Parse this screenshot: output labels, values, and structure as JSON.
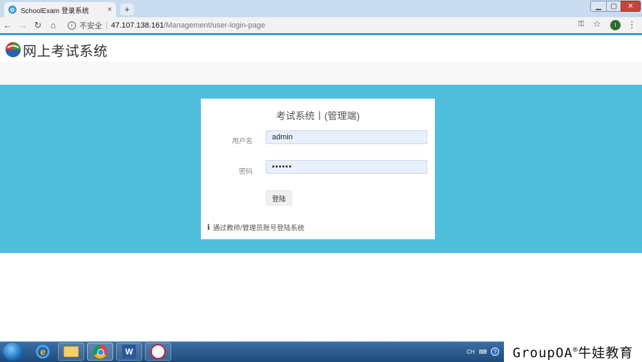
{
  "browser": {
    "tab_title": "SchoolExam 登录系统",
    "tab_close": "×",
    "new_tab": "+",
    "security_label": "不安全",
    "url_host": "47.107.138.161",
    "url_path": "/Management/user-login-page",
    "window_controls": {
      "minimize": "▁",
      "maximize": "▢",
      "close": "✕"
    },
    "avatar_letter": "I"
  },
  "site": {
    "title": "网上考试系统",
    "logo_colors": {
      "red": "#e23c2d",
      "green": "#3a9a3a",
      "blue": "#2a5fb0"
    }
  },
  "login": {
    "heading": "考试系统丨(管理端)",
    "username_label": "用户名",
    "username_value": "admin",
    "password_label": "密码",
    "password_value": "••••••",
    "submit_label": "登陆",
    "hint_icon": "ℹ",
    "hint_text": "通过教师/管理员账号登陆系统"
  },
  "colors": {
    "banner": "#4fbedb",
    "accent": "#3d96d6"
  },
  "taskbar": {
    "tray_lang": "CH",
    "tray_help": "?"
  },
  "watermark": {
    "text": "GroupOA",
    "reg": "®",
    "brand": "牛娃教育"
  }
}
